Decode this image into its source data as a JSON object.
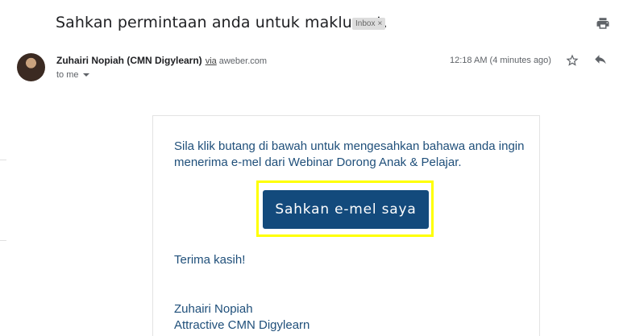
{
  "header": {
    "subject": "Sahkan permintaan anda untuk maklumat.",
    "label": "Inbox",
    "label_remove": "×"
  },
  "message_meta": {
    "sender_name": "Zuhairi Nopiah (CMN Digylearn)",
    "via_label": "via",
    "via_domain": "aweber.com",
    "recipient": "to me",
    "timestamp": "12:18 AM (4 minutes ago)"
  },
  "icons": {
    "print": "print-icon",
    "star": "star-outline-icon",
    "reply": "reply-arrow-icon",
    "dropdown": "caret-down-icon"
  },
  "email_body": {
    "paragraph": "Sila klik butang di bawah untuk mengesahkan bahawa anda ingin menerima e-mel dari Webinar Dorong Anak & Pelajar.",
    "cta_label": "Sahkan e-mel saya",
    "thanks": "Terima kasih!",
    "signature_name": "Zuhairi Nopiah",
    "signature_org": "Attractive CMN Digylearn"
  },
  "colors": {
    "cta_background": "#134a7c",
    "body_text": "#1f4f7a",
    "highlight_border": "#ffff00",
    "label_chip": "#dddddd"
  }
}
